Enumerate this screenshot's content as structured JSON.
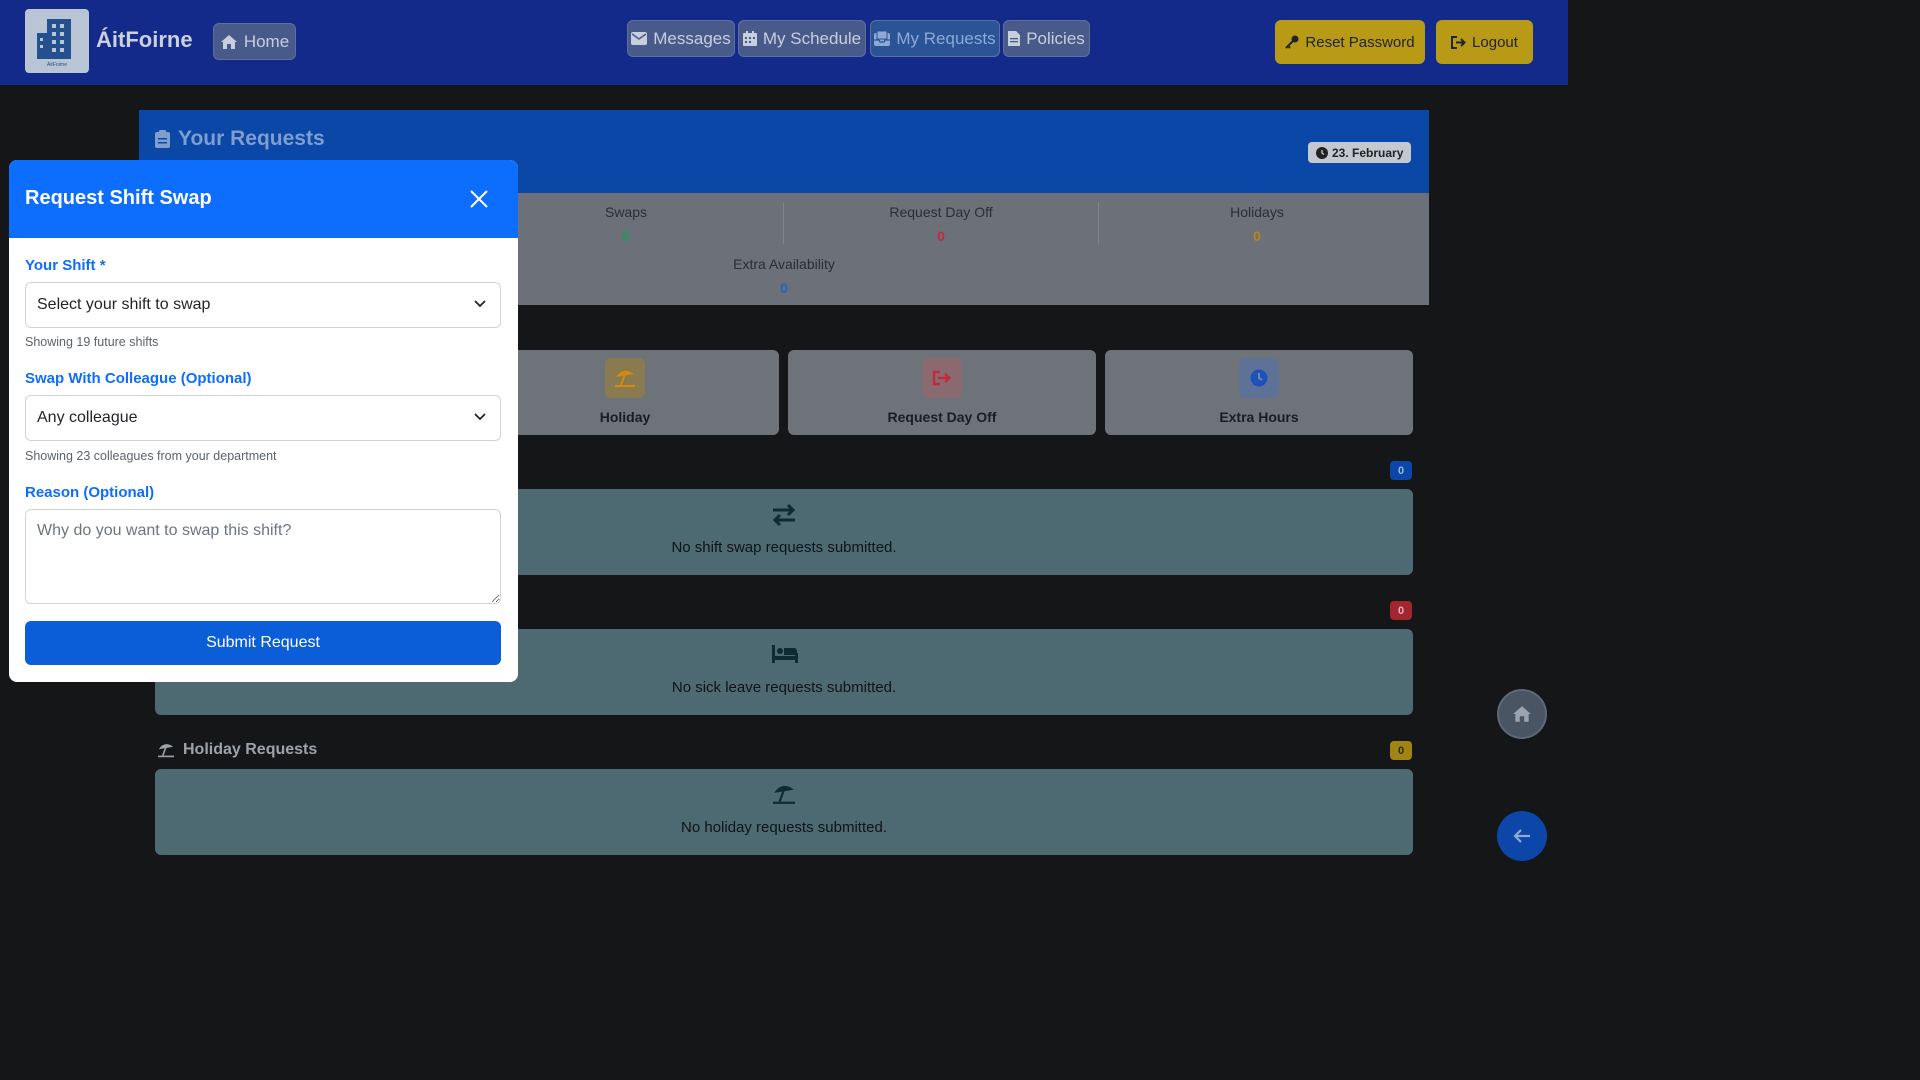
{
  "navbar": {
    "brand": "ÁitFoirne",
    "logo_caption": "ÁitFoirne",
    "home_label": "Home",
    "messages_label": "Messages",
    "schedule_label": "My Schedule",
    "requests_label": "My Requests",
    "policies_label": "Policies",
    "reset_password_label": "Reset Password",
    "logout_label": "Logout"
  },
  "page": {
    "title": "Your Requests",
    "date_badge": "23. February"
  },
  "stats": {
    "swaps": {
      "label": "Swaps",
      "value": "0"
    },
    "day_off": {
      "label": "Request Day Off",
      "value": "0"
    },
    "holidays": {
      "label": "Holidays",
      "value": "0"
    },
    "extra": {
      "label": "Extra Availability",
      "value": "0"
    }
  },
  "actions": {
    "holiday": "Holiday",
    "day_off": "Request Day Off",
    "extra_hours": "Extra Hours"
  },
  "sections": {
    "swap": {
      "count": "0",
      "empty_text": "No shift swap requests submitted."
    },
    "sick": {
      "count": "0",
      "empty_text": "No sick leave requests submitted."
    },
    "holiday": {
      "title": "Holiday Requests",
      "count": "0",
      "empty_text": "No holiday requests submitted."
    }
  },
  "modal": {
    "title": "Request Shift Swap",
    "shift_label": "Your Shift *",
    "shift_selected": "Select your shift to swap",
    "shift_help": "Showing 19 future shifts",
    "colleague_label": "Swap With Colleague (Optional)",
    "colleague_selected": "Any colleague",
    "colleague_help": "Showing 23 colleagues from your department",
    "reason_label": "Reason (Optional)",
    "reason_placeholder": "Why do you want to swap this shift?",
    "submit_label": "Submit Request"
  },
  "colors": {
    "navbar": "#142a8a",
    "primary": "#0d6efd",
    "warning": "#b89a16",
    "success": "#1f9a5c",
    "danger": "#c42b3a"
  },
  "icons": [
    "building-icon",
    "home-icon",
    "envelope-icon",
    "calendar-icon",
    "inbox-icon",
    "file-icon",
    "key-icon",
    "logout-icon",
    "clipboard-icon",
    "clock-icon",
    "umbrella-beach-icon",
    "sign-out-icon",
    "swap-arrows-icon",
    "bed-icon",
    "close-icon",
    "chevron-down-icon",
    "arrow-left-icon"
  ]
}
